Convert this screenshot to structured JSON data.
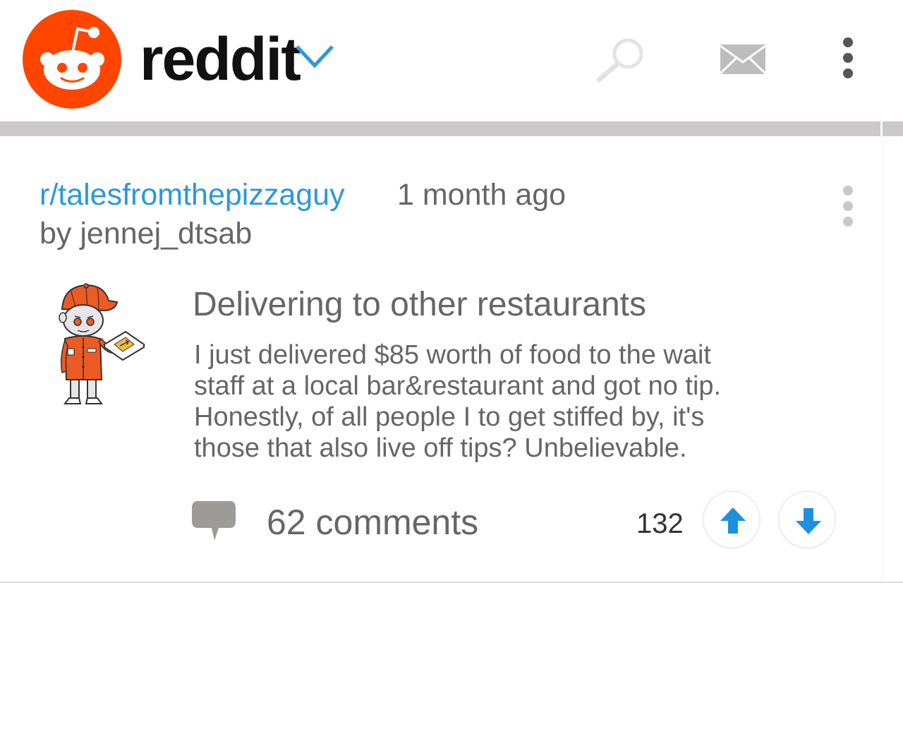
{
  "header": {
    "app_name": "reddit",
    "icons": [
      "reddit-alien-logo",
      "chevron-down-icon",
      "search-icon",
      "mail-icon",
      "more-vert-icon"
    ]
  },
  "post": {
    "subreddit": "r/talesfromthepizzaguy",
    "time": "1 month ago",
    "author": "by jennej_dtsab",
    "title": "Delivering to other restaurants",
    "body_lines": [
      "I just delivered $85 worth of food to the wait",
      "staff at a local bar&restaurant and got no tip.",
      "Honestly, of all people I to get stiffed by, it's",
      "those that also live off tips? Unbelievable."
    ],
    "comments": "62 comments",
    "score": "132",
    "icons": [
      "more-vert-icon",
      "pizza-guy-avatar",
      "comment-icon",
      "upvote-arrow-icon",
      "downvote-arrow-icon"
    ]
  },
  "colors": {
    "brand": "#ff4500",
    "link": "#2a9ad8",
    "vote_arrow": "#1e90e0",
    "divider": "#cbc9ca",
    "muted_text": "#666666"
  }
}
